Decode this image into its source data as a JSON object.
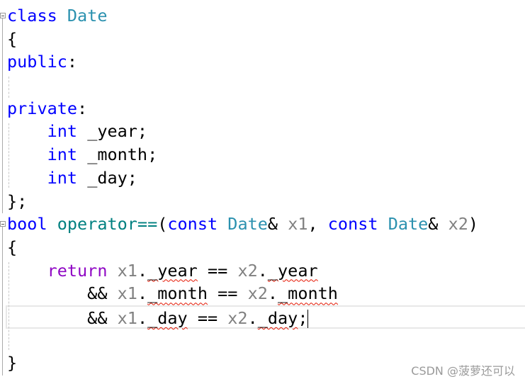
{
  "editor": {
    "lines": [
      [
        [
          "class",
          "kw"
        ],
        [
          " ",
          ""
        ],
        [
          "Date",
          "type"
        ]
      ],
      [
        [
          "{",
          ""
        ]
      ],
      [
        [
          "public",
          "kw"
        ],
        [
          ":",
          ""
        ]
      ],
      [],
      [
        [
          "private",
          "kw"
        ],
        [
          ":",
          ""
        ]
      ],
      [
        [
          "    ",
          ""
        ],
        [
          "int",
          "kw"
        ],
        [
          " _year;",
          ""
        ]
      ],
      [
        [
          "    ",
          ""
        ],
        [
          "int",
          "kw"
        ],
        [
          " _month;",
          ""
        ]
      ],
      [
        [
          "    ",
          ""
        ],
        [
          "int",
          "kw"
        ],
        [
          " _day;",
          ""
        ]
      ],
      [
        [
          "};",
          ""
        ]
      ],
      [
        [
          "bool",
          "kw"
        ],
        [
          " ",
          ""
        ],
        [
          "operator==",
          "fn"
        ],
        [
          "(",
          ""
        ],
        [
          "const",
          "kw"
        ],
        [
          " ",
          ""
        ],
        [
          "Date",
          "type"
        ],
        [
          "& ",
          ""
        ],
        [
          "x1",
          "param"
        ],
        [
          ", ",
          ""
        ],
        [
          "const",
          "kw"
        ],
        [
          " ",
          ""
        ],
        [
          "Date",
          "type"
        ],
        [
          "& ",
          ""
        ],
        [
          "x2",
          "param"
        ],
        [
          ")",
          ""
        ]
      ],
      [
        [
          "{",
          ""
        ]
      ],
      [
        [
          "    ",
          ""
        ],
        [
          "return",
          "ctl"
        ],
        [
          " ",
          ""
        ],
        [
          "x1",
          "param"
        ],
        [
          ".",
          ""
        ],
        [
          "_year",
          "err"
        ],
        [
          " == ",
          ""
        ],
        [
          "x2",
          "param"
        ],
        [
          ".",
          ""
        ],
        [
          "_year",
          "err"
        ]
      ],
      [
        [
          "        && ",
          ""
        ],
        [
          "x1",
          "param"
        ],
        [
          ".",
          ""
        ],
        [
          "_month",
          "err"
        ],
        [
          " == ",
          ""
        ],
        [
          "x2",
          "param"
        ],
        [
          ".",
          ""
        ],
        [
          "_month",
          "err"
        ]
      ],
      [
        [
          "        && ",
          ""
        ],
        [
          "x1",
          "param"
        ],
        [
          ".",
          ""
        ],
        [
          "_day",
          "err"
        ],
        [
          " == ",
          ""
        ],
        [
          "x2",
          "param"
        ],
        [
          ".",
          ""
        ],
        [
          "_day",
          "err"
        ],
        [
          ";",
          ""
        ]
      ],
      [],
      [
        [
          "}",
          ""
        ]
      ]
    ],
    "current_line": 13,
    "colors": {
      "keyword": "#0000ff",
      "type": "#2b91af",
      "function": "#008080",
      "control": "#8f08c4",
      "parameter": "#808080",
      "error_squiggle": "#e51400"
    }
  },
  "watermark": "CSDN @菠萝还可以"
}
